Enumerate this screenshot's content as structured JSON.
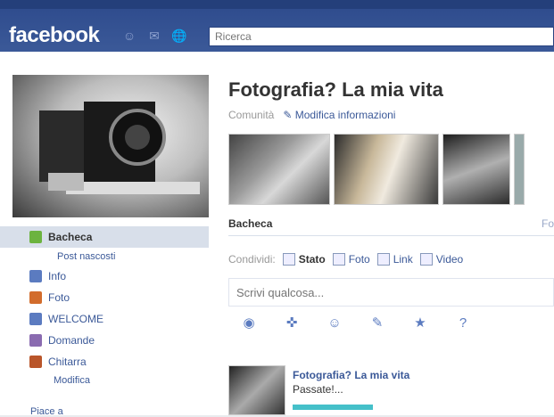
{
  "header": {
    "logo": "facebook",
    "search_placeholder": "Ricerca",
    "icons": [
      "friends-icon",
      "messages-icon",
      "notifications-icon"
    ]
  },
  "sidebar": {
    "items": [
      {
        "label": "Bacheca",
        "icon": "wall-icon",
        "color": "#6cb33f",
        "active": true
      },
      {
        "label": "Post nascosti",
        "sub": true
      },
      {
        "label": "Info",
        "icon": "info-icon",
        "color": "#5b7bc0"
      },
      {
        "label": "Foto",
        "icon": "photo-icon",
        "color": "#d26c2c"
      },
      {
        "label": "WELCOME",
        "icon": "welcome-icon",
        "color": "#5b7bc0"
      },
      {
        "label": "Domande",
        "icon": "questions-icon",
        "color": "#8a6bb0"
      },
      {
        "label": "Chitarra",
        "icon": "guitar-icon",
        "color": "#b9552a"
      },
      {
        "label": "Modifica",
        "sub": true
      }
    ],
    "more": "Piace a"
  },
  "page": {
    "title": "Fotografia? La mia vita",
    "category": "Comunità",
    "edit_info": "Modifica informazioni"
  },
  "wall": {
    "tab": "Bacheca",
    "tab_right": "Fo",
    "share_label": "Condividi:",
    "share_items": [
      "Stato",
      "Foto",
      "Link",
      "Video"
    ],
    "composer_placeholder": "Scrivi qualcosa..."
  },
  "post": {
    "author": "Fotografia? La mia vita",
    "text": "Passate!..."
  },
  "colors": {
    "brand": "#3b5998",
    "accent_bar": "#45c0c9"
  }
}
